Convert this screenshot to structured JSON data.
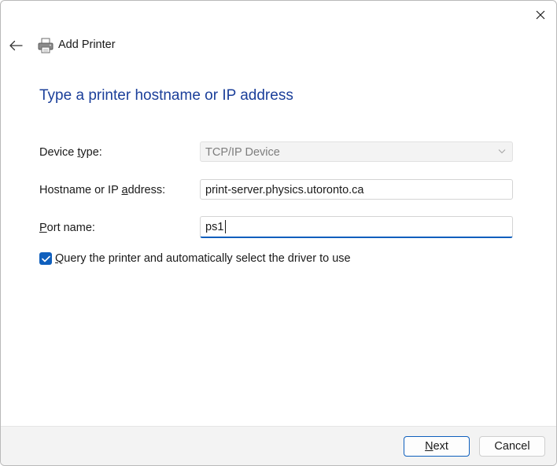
{
  "window": {
    "title": "Add Printer",
    "heading": "Type a printer hostname or IP address"
  },
  "form": {
    "device_type": {
      "label_pre": "Device ",
      "label_mnemonic": "t",
      "label_post": "ype:",
      "value": "TCP/IP Device"
    },
    "hostname": {
      "label_pre": "Hostname or IP ",
      "label_mnemonic": "a",
      "label_post": "ddress:",
      "value": "print-server.physics.utoronto.ca"
    },
    "port": {
      "label_pre": "",
      "label_mnemonic": "P",
      "label_post": "ort name:",
      "value": "ps1"
    },
    "query_checkbox": {
      "checked": true,
      "label_mnemonic": "Q",
      "label_post": "uery the printer and automatically select the driver to use"
    }
  },
  "footer": {
    "next_mnemonic": "N",
    "next_post": "ext",
    "cancel_label": "Cancel"
  },
  "icons": {
    "close": "close-icon",
    "back": "back-arrow-icon",
    "printer": "printer-icon",
    "dropdown": "chevron-down-icon",
    "check": "checkmark-icon"
  },
  "colors": {
    "accent": "#0f5fbd",
    "heading": "#1b3f9a"
  }
}
